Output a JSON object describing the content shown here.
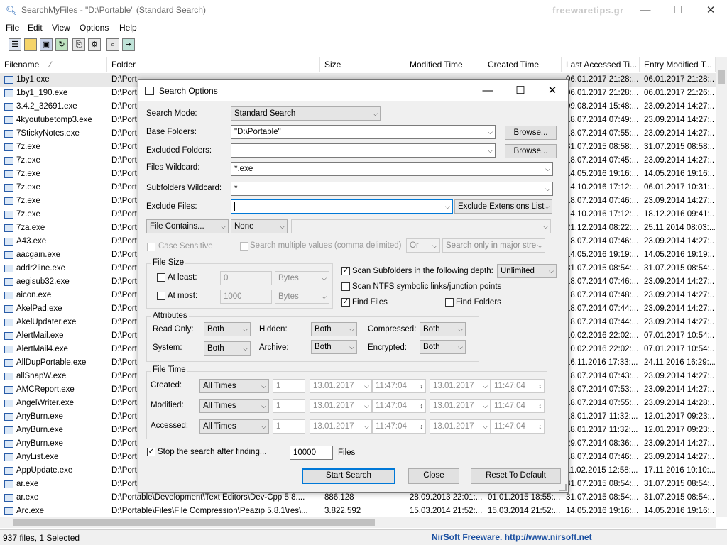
{
  "window": {
    "title": "SearchMyFiles -  \"D:\\Portable\"  (Standard Search)",
    "watermark": "freewaretips.gr"
  },
  "menu": [
    "File",
    "Edit",
    "View",
    "Options",
    "Help"
  ],
  "columns": [
    "Filename",
    "Folder",
    "Size",
    "Modified Time",
    "Created Time",
    "Last Accessed Ti...",
    "Entry Modified T..."
  ],
  "sort_indicator": "⁄",
  "rows": [
    {
      "name": "1by1.exe",
      "folder": "D:\\Port",
      "accessed": "06.01.2017 21:28:...",
      "entry": "06.01.2017 21:28:..."
    },
    {
      "name": "1by1_190.exe",
      "folder": "D:\\Port",
      "accessed": "06.01.2017 21:28:...",
      "entry": "06.01.2017 21:26:..."
    },
    {
      "name": "3.4.2_32691.exe",
      "folder": "D:\\Port",
      "accessed": "09.08.2014 15:48:...",
      "entry": "23.09.2014 14:27:..."
    },
    {
      "name": "4kyoutubetomp3.exe",
      "folder": "D:\\Port",
      "accessed": "18.07.2014 07:49:...",
      "entry": "23.09.2014 14:27:..."
    },
    {
      "name": "7StickyNotes.exe",
      "folder": "D:\\Port",
      "accessed": "18.07.2014 07:55:...",
      "entry": "23.09.2014 14:27:..."
    },
    {
      "name": "7z.exe",
      "folder": "D:\\Port",
      "accessed": "31.07.2015 08:58:...",
      "entry": "31.07.2015 08:58:..."
    },
    {
      "name": "7z.exe",
      "folder": "D:\\Port",
      "accessed": "18.07.2014 07:45:...",
      "entry": "23.09.2014 14:27:..."
    },
    {
      "name": "7z.exe",
      "folder": "D:\\Port",
      "accessed": "14.05.2016 19:16:...",
      "entry": "14.05.2016 19:16:..."
    },
    {
      "name": "7z.exe",
      "folder": "D:\\Port",
      "accessed": "14.10.2016 17:12:...",
      "entry": "06.01.2017 10:31:..."
    },
    {
      "name": "7z.exe",
      "folder": "D:\\Port",
      "accessed": "18.07.2014 07:46:...",
      "entry": "23.09.2014 14:27:..."
    },
    {
      "name": "7z.exe",
      "folder": "D:\\Port",
      "accessed": "14.10.2016 17:12:...",
      "entry": "18.12.2016 09:41:..."
    },
    {
      "name": "7za.exe",
      "folder": "D:\\Port",
      "accessed": "21.12.2014 08:22:...",
      "entry": "25.11.2014 08:03:..."
    },
    {
      "name": "A43.exe",
      "folder": "D:\\Port",
      "accessed": "18.07.2014 07:46:...",
      "entry": "23.09.2014 14:27:..."
    },
    {
      "name": "aacgain.exe",
      "folder": "D:\\Port",
      "accessed": "14.05.2016 19:19:...",
      "entry": "14.05.2016 19:19:..."
    },
    {
      "name": "addr2line.exe",
      "folder": "D:\\Port",
      "accessed": "31.07.2015 08:54:...",
      "entry": "31.07.2015 08:54:..."
    },
    {
      "name": "aegisub32.exe",
      "folder": "D:\\Port",
      "accessed": "18.07.2014 07:46:...",
      "entry": "23.09.2014 14:27:..."
    },
    {
      "name": "aicon.exe",
      "folder": "D:\\Port",
      "accessed": "18.07.2014 07:48:...",
      "entry": "23.09.2014 14:27:..."
    },
    {
      "name": "AkelPad.exe",
      "folder": "D:\\Port",
      "accessed": "18.07.2014 07:44:...",
      "entry": "23.09.2014 14:27:..."
    },
    {
      "name": "AkelUpdater.exe",
      "folder": "D:\\Port",
      "accessed": "18.07.2014 07:44:...",
      "entry": "23.09.2014 14:27:..."
    },
    {
      "name": "AlertMail.exe",
      "folder": "D:\\Port",
      "accessed": "10.02.2016 22:02:...",
      "entry": "07.01.2017 10:54:..."
    },
    {
      "name": "AlertMail4.exe",
      "folder": "D:\\Port",
      "accessed": "10.02.2016 22:02:...",
      "entry": "07.01.2017 10:54:..."
    },
    {
      "name": "AllDupPortable.exe",
      "folder": "D:\\Port",
      "accessed": "16.11.2016 17:33:...",
      "entry": "24.11.2016 16:29:..."
    },
    {
      "name": "allSnapW.exe",
      "folder": "D:\\Port",
      "accessed": "18.07.2014 07:43:...",
      "entry": "23.09.2014 14:27:..."
    },
    {
      "name": "AMCReport.exe",
      "folder": "D:\\Port",
      "accessed": "18.07.2014 07:53:...",
      "entry": "23.09.2014 14:27:..."
    },
    {
      "name": "AngelWriter.exe",
      "folder": "D:\\Port",
      "accessed": "18.07.2014 07:55:...",
      "entry": "23.09.2014 14:28:..."
    },
    {
      "name": "AnyBurn.exe",
      "folder": "D:\\Port",
      "accessed": "18.01.2017 11:32:...",
      "entry": "12.01.2017 09:23:..."
    },
    {
      "name": "AnyBurn.exe",
      "folder": "D:\\Port",
      "accessed": "18.01.2017 11:32:...",
      "entry": "12.01.2017 09:23:..."
    },
    {
      "name": "AnyBurn.exe",
      "folder": "D:\\Port",
      "accessed": "29.07.2014 08:36:...",
      "entry": "23.09.2014 14:27:..."
    },
    {
      "name": "AnyList.exe",
      "folder": "D:\\Port",
      "accessed": "18.07.2014 07:46:...",
      "entry": "23.09.2014 14:27:..."
    },
    {
      "name": "AppUpdate.exe",
      "folder": "D:\\Port",
      "accessed": "11.02.2015 12:58:...",
      "entry": "17.11.2016 10:10:..."
    },
    {
      "name": "ar.exe",
      "folder": "D:\\Port",
      "accessed": "31.07.2015 08:54:...",
      "entry": "31.07.2015 08:54:..."
    },
    {
      "name": "ar.exe",
      "folder": "D:\\Portable\\Development\\Text Editors\\Dev-Cpp 5.8....",
      "size": "886,128",
      "modified": "28.09.2013 22:01:...",
      "created": "01.01.2015 18:55:...",
      "accessed": "31.07.2015 08:54:...",
      "entry": "31.07.2015 08:54:..."
    },
    {
      "name": "Arc.exe",
      "folder": "D:\\Portable\\Files\\File Compression\\Peazip 5.8.1\\res\\...",
      "size": "3.822.592",
      "modified": "15.03.2014 21:52:...",
      "created": "15.03.2014 21:52:...",
      "accessed": "14.05.2016 19:16:...",
      "entry": "14.05.2016 19:16:..."
    }
  ],
  "status": {
    "left": "937 files, 1 Selected",
    "right": "NirSoft Freeware.  http://www.nirsoft.net"
  },
  "dialog": {
    "title": "Search Options",
    "search_mode_label": "Search Mode:",
    "search_mode": "Standard Search",
    "base_folders_label": "Base Folders:",
    "base_folders": "\"D:\\Portable\"",
    "excluded_folders_label": "Excluded Folders:",
    "excluded_folders": "",
    "browse": "Browse...",
    "files_wildcard_label": "Files Wildcard:",
    "files_wildcard": "*.exe",
    "subfolders_wildcard_label": "Subfolders Wildcard:",
    "subfolders_wildcard": "*",
    "exclude_files_label": "Exclude Files:",
    "exclude_files": "",
    "exclude_ext": "Exclude Extensions List",
    "file_contains": "File Contains...",
    "contains_mode": "None",
    "case_sensitive": "Case Sensitive",
    "multi_values": "Search multiple values (comma delimited)",
    "or": "Or",
    "major_streams": "Search only in major stre",
    "file_size": {
      "title": "File Size",
      "at_least": "At least:",
      "at_most": "At most:",
      "min": "0",
      "max": "1000",
      "unit": "Bytes"
    },
    "scan_subfolders": "Scan Subfolders in the following depth:",
    "depth": "Unlimited",
    "scan_ntfs": "Scan NTFS symbolic links/junction points",
    "find_files": "Find Files",
    "find_folders": "Find Folders",
    "attributes": {
      "title": "Attributes",
      "read_only": "Read Only:",
      "hidden": "Hidden:",
      "compressed": "Compressed:",
      "system": "System:",
      "archive": "Archive:",
      "encrypted": "Encrypted:",
      "value": "Both"
    },
    "file_time": {
      "title": "File Time",
      "created": "Created:",
      "modified": "Modified:",
      "accessed": "Accessed:",
      "mode": "All Times",
      "n": "1",
      "date": "13.01.2017",
      "time": "11:47:04"
    },
    "stop_after": "Stop the search after finding...",
    "stop_count": "10000",
    "files": "Files",
    "start": "Start Search",
    "close": "Close",
    "reset": "Reset To Default"
  }
}
